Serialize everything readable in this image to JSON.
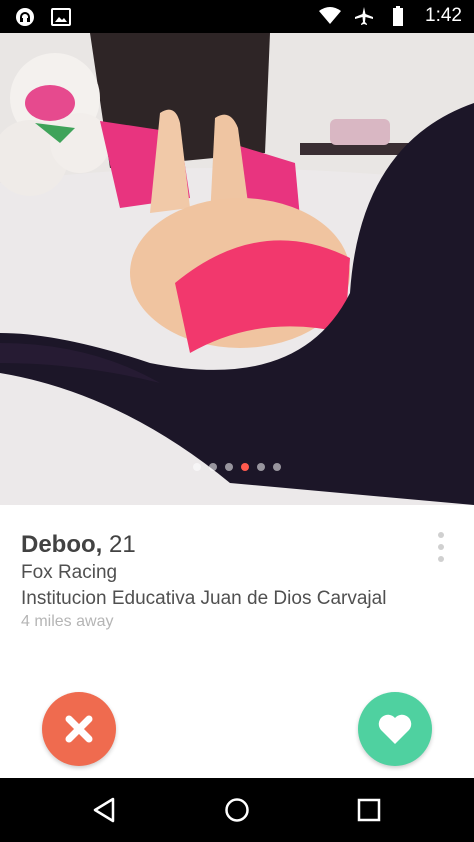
{
  "status_bar": {
    "time": "1:42",
    "icons": [
      "headphones-icon",
      "image-icon",
      "wifi-icon",
      "airplane-icon",
      "battery-icon"
    ]
  },
  "photo": {
    "page_count": 6,
    "active_index": 3
  },
  "profile": {
    "name": "Deboo,",
    "age": "21",
    "work": "Fox Racing",
    "school": "Institucion Educativa Juan de Dios Carvajal",
    "distance": "4 miles away"
  },
  "actions": {
    "nope_icon": "close-icon",
    "like_icon": "heart-icon",
    "nope_color": "#ef6b4f",
    "like_color": "#4fd1a0"
  },
  "nav": [
    "back-icon",
    "home-icon",
    "recents-icon"
  ]
}
